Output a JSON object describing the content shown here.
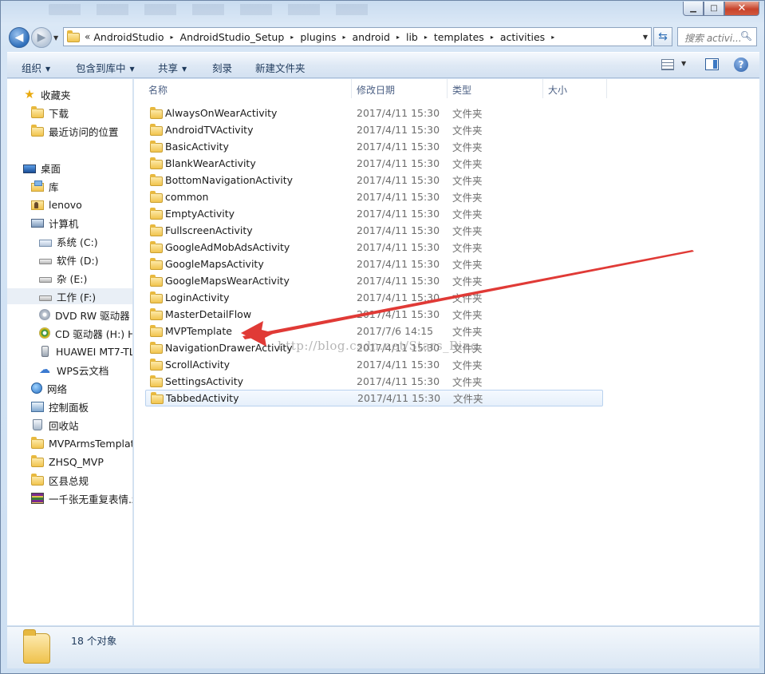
{
  "window": {
    "minimize": "▁",
    "maximize": "□",
    "close": "✕"
  },
  "address": {
    "overflow": "«",
    "crumbs": [
      "AndroidStudio",
      "AndroidStudio_Setup",
      "plugins",
      "android",
      "lib",
      "templates",
      "activities"
    ]
  },
  "search": {
    "placeholder": "搜索 activi..."
  },
  "toolbar": {
    "organize": "组织",
    "include_in_library": "包含到库中",
    "share": "共享",
    "burn": "刻录",
    "new_folder": "新建文件夹",
    "help": "?"
  },
  "sidebar": {
    "favorites": {
      "label": "收藏夹",
      "items": [
        "下载",
        "最近访问的位置"
      ]
    },
    "desktop": "桌面",
    "library": "库",
    "user": "lenovo",
    "computer": "计算机",
    "drives": [
      "系统 (C:)",
      "软件 (D:)",
      "杂 (E:)",
      "工作 (F:)",
      "DVD RW 驱动器 (",
      "CD 驱动器 (H:) Hi",
      "HUAWEI MT7-TL",
      "WPS云文档"
    ],
    "network": "网络",
    "control_panel": "控制面板",
    "recycle_bin": "回收站",
    "extra": [
      "MVPArmsTemplate",
      "ZHSQ_MVP",
      "区县总规",
      "一千张无重复表情.z"
    ]
  },
  "columns": {
    "name": "名称",
    "modified": "修改日期",
    "type": "类型",
    "size": "大小"
  },
  "files": [
    {
      "name": "AlwaysOnWearActivity",
      "date": "2017/4/11 15:30",
      "type": "文件夹"
    },
    {
      "name": "AndroidTVActivity",
      "date": "2017/4/11 15:30",
      "type": "文件夹"
    },
    {
      "name": "BasicActivity",
      "date": "2017/4/11 15:30",
      "type": "文件夹"
    },
    {
      "name": "BlankWearActivity",
      "date": "2017/4/11 15:30",
      "type": "文件夹"
    },
    {
      "name": "BottomNavigationActivity",
      "date": "2017/4/11 15:30",
      "type": "文件夹"
    },
    {
      "name": "common",
      "date": "2017/4/11 15:30",
      "type": "文件夹"
    },
    {
      "name": "EmptyActivity",
      "date": "2017/4/11 15:30",
      "type": "文件夹"
    },
    {
      "name": "FullscreenActivity",
      "date": "2017/4/11 15:30",
      "type": "文件夹"
    },
    {
      "name": "GoogleAdMobAdsActivity",
      "date": "2017/4/11 15:30",
      "type": "文件夹"
    },
    {
      "name": "GoogleMapsActivity",
      "date": "2017/4/11 15:30",
      "type": "文件夹"
    },
    {
      "name": "GoogleMapsWearActivity",
      "date": "2017/4/11 15:30",
      "type": "文件夹"
    },
    {
      "name": "LoginActivity",
      "date": "2017/4/11 15:30",
      "type": "文件夹"
    },
    {
      "name": "MasterDetailFlow",
      "date": "2017/4/11 15:30",
      "type": "文件夹"
    },
    {
      "name": "MVPTemplate",
      "date": "2017/7/6 14:15",
      "type": "文件夹"
    },
    {
      "name": "NavigationDrawerActivity",
      "date": "2017/4/11 15:30",
      "type": "文件夹"
    },
    {
      "name": "ScrollActivity",
      "date": "2017/4/11 15:30",
      "type": "文件夹"
    },
    {
      "name": "SettingsActivity",
      "date": "2017/4/11 15:30",
      "type": "文件夹"
    },
    {
      "name": "TabbedActivity",
      "date": "2017/4/11 15:30",
      "type": "文件夹"
    }
  ],
  "selected_file": "TabbedActivity",
  "watermark": "http://blog.csdn.net/Stars_Bing",
  "status": {
    "count": "18 个对象"
  },
  "colors": {
    "arrow": "#e03a36",
    "selection": "#e6f0fb"
  }
}
